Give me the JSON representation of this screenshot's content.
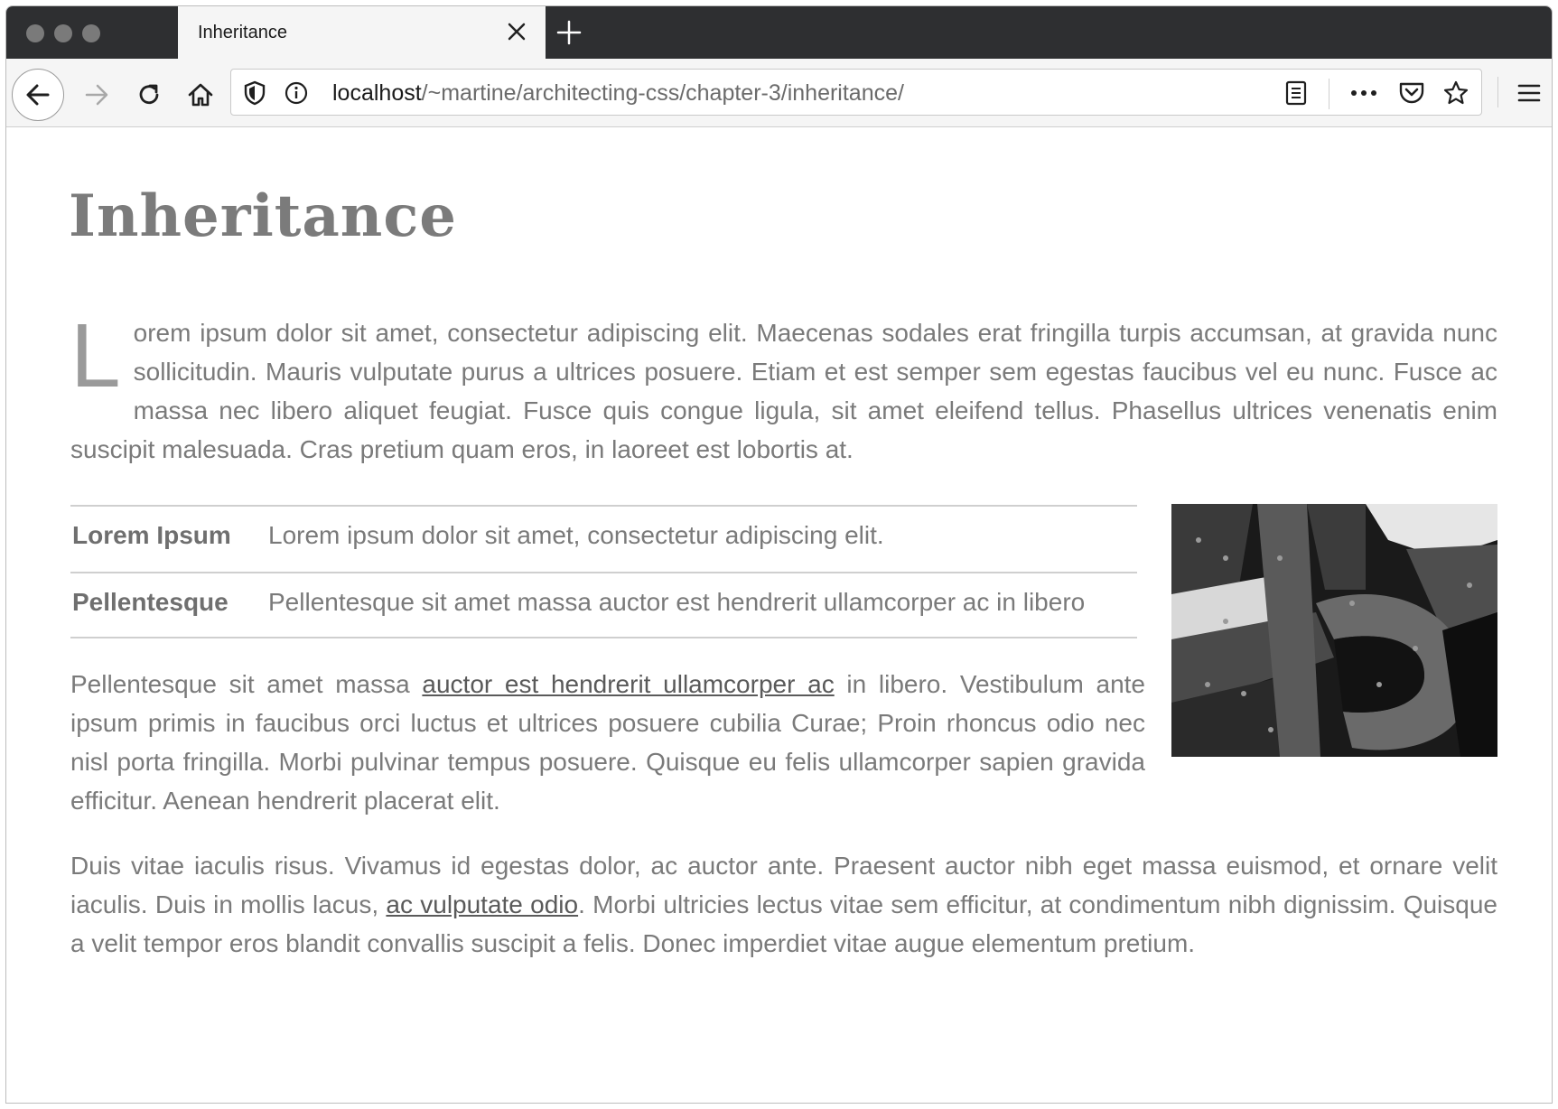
{
  "browser": {
    "tab_title": "Inheritance",
    "url_host": "localhost",
    "url_path": "/~martine/architecting-css/chapter-3/inheritance/"
  },
  "page": {
    "title": "Inheritance",
    "intro": {
      "dropcap": "L",
      "text": "orem ipsum dolor sit amet, consectetur adipiscing elit. Maecenas sodales erat fringilla turpis accumsan, at gravida nunc sollicitudin. Mauris vulputate purus a ultrices posuere. Etiam et est semper sem egestas faucibus vel eu nunc. Fusce ac massa nec libero aliquet feugiat. Fusce quis congue ligula, sit amet eleifend tellus. Phasellus ultrices venenatis enim suscipit malesuada. Cras pretium quam eros, in laoreet est lobortis at."
    },
    "definitions": [
      {
        "term": "Lorem Ipsum",
        "description": "Lorem ipsum dolor sit amet, consectetur adipiscing elit."
      },
      {
        "term": "Pellentesque",
        "description": "Pellentesque sit amet massa auctor est hendrerit ullamcorper ac in libero"
      }
    ],
    "para2": {
      "before": "Pellentesque sit amet massa ",
      "link": "auctor est hendrerit ullamcorper ac",
      "after": " in libero. Vestibulum ante ipsum primis in faucibus orci luctus et ultrices posuere cubilia Curae; Proin rhoncus odio nec nisl porta fringilla. Morbi pulvinar tempus posuere. Quisque eu felis ullamcorper sapien gravida efficitur. Aenean hendrerit placerat elit."
    },
    "para3": {
      "before": "Duis vitae iaculis risus. Vivamus id egestas dolor, ac auctor ante. Praesent auctor nibh eget massa euismod, et ornare velit iaculis. Duis in mollis lacus, ",
      "link": "ac vulputate odio",
      "after": ". Morbi ultricies lectus vitae sem efficitur, at condimentum nibh dignissim. Quisque a velit tempor eros blandit convallis suscipit a felis. Donec imperdiet vitae augue elementum pretium."
    }
  }
}
